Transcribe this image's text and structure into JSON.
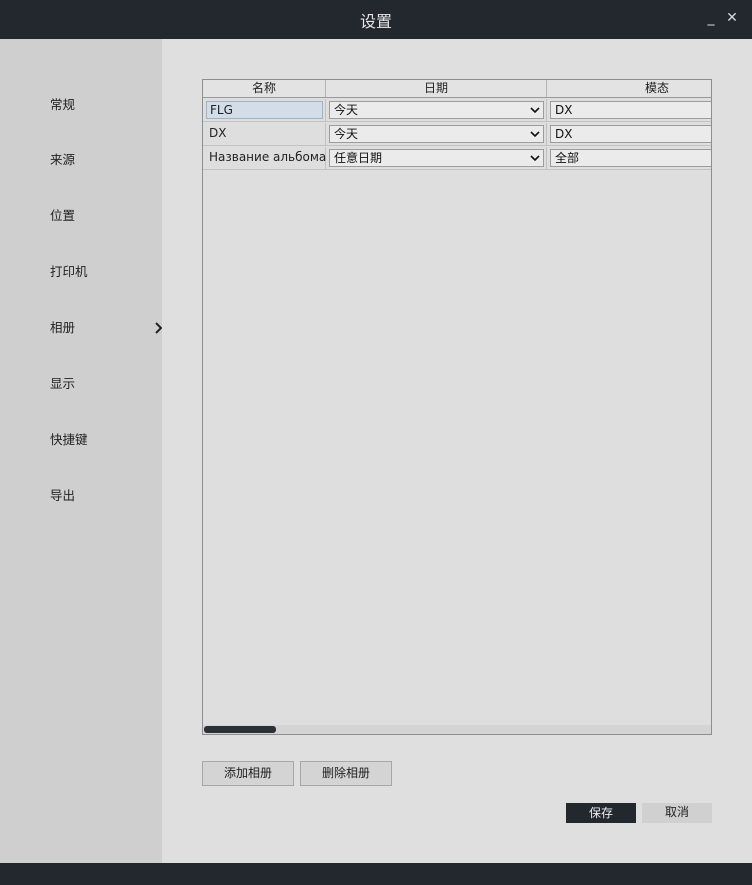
{
  "window": {
    "title": "设置",
    "minimize_glyph": "_",
    "close_glyph": "✕"
  },
  "sidebar": {
    "items": [
      {
        "label": "常规"
      },
      {
        "label": "来源"
      },
      {
        "label": "位置"
      },
      {
        "label": "打印机"
      },
      {
        "label": "相册",
        "active": true,
        "icon": "chevron-right-icon"
      },
      {
        "label": "显示"
      },
      {
        "label": "快捷键"
      },
      {
        "label": "导出"
      }
    ]
  },
  "table": {
    "columns": [
      "名称",
      "日期",
      "模态"
    ],
    "rows": [
      {
        "name": "FLG",
        "date": "今天",
        "modality": "DX",
        "editing": true
      },
      {
        "name": "DX",
        "date": "今天",
        "modality": "DX"
      },
      {
        "name": "Название альбома",
        "date": "任意日期",
        "modality": "全部"
      }
    ]
  },
  "buttons": {
    "add_album": "添加相册",
    "delete_album": "删除相册",
    "save": "保存",
    "cancel": "取消"
  },
  "colors": {
    "titlebar": "#23272e",
    "sidebar": "#cfcfcf",
    "main": "#dfdfdf",
    "primary_button": "#23272e"
  }
}
